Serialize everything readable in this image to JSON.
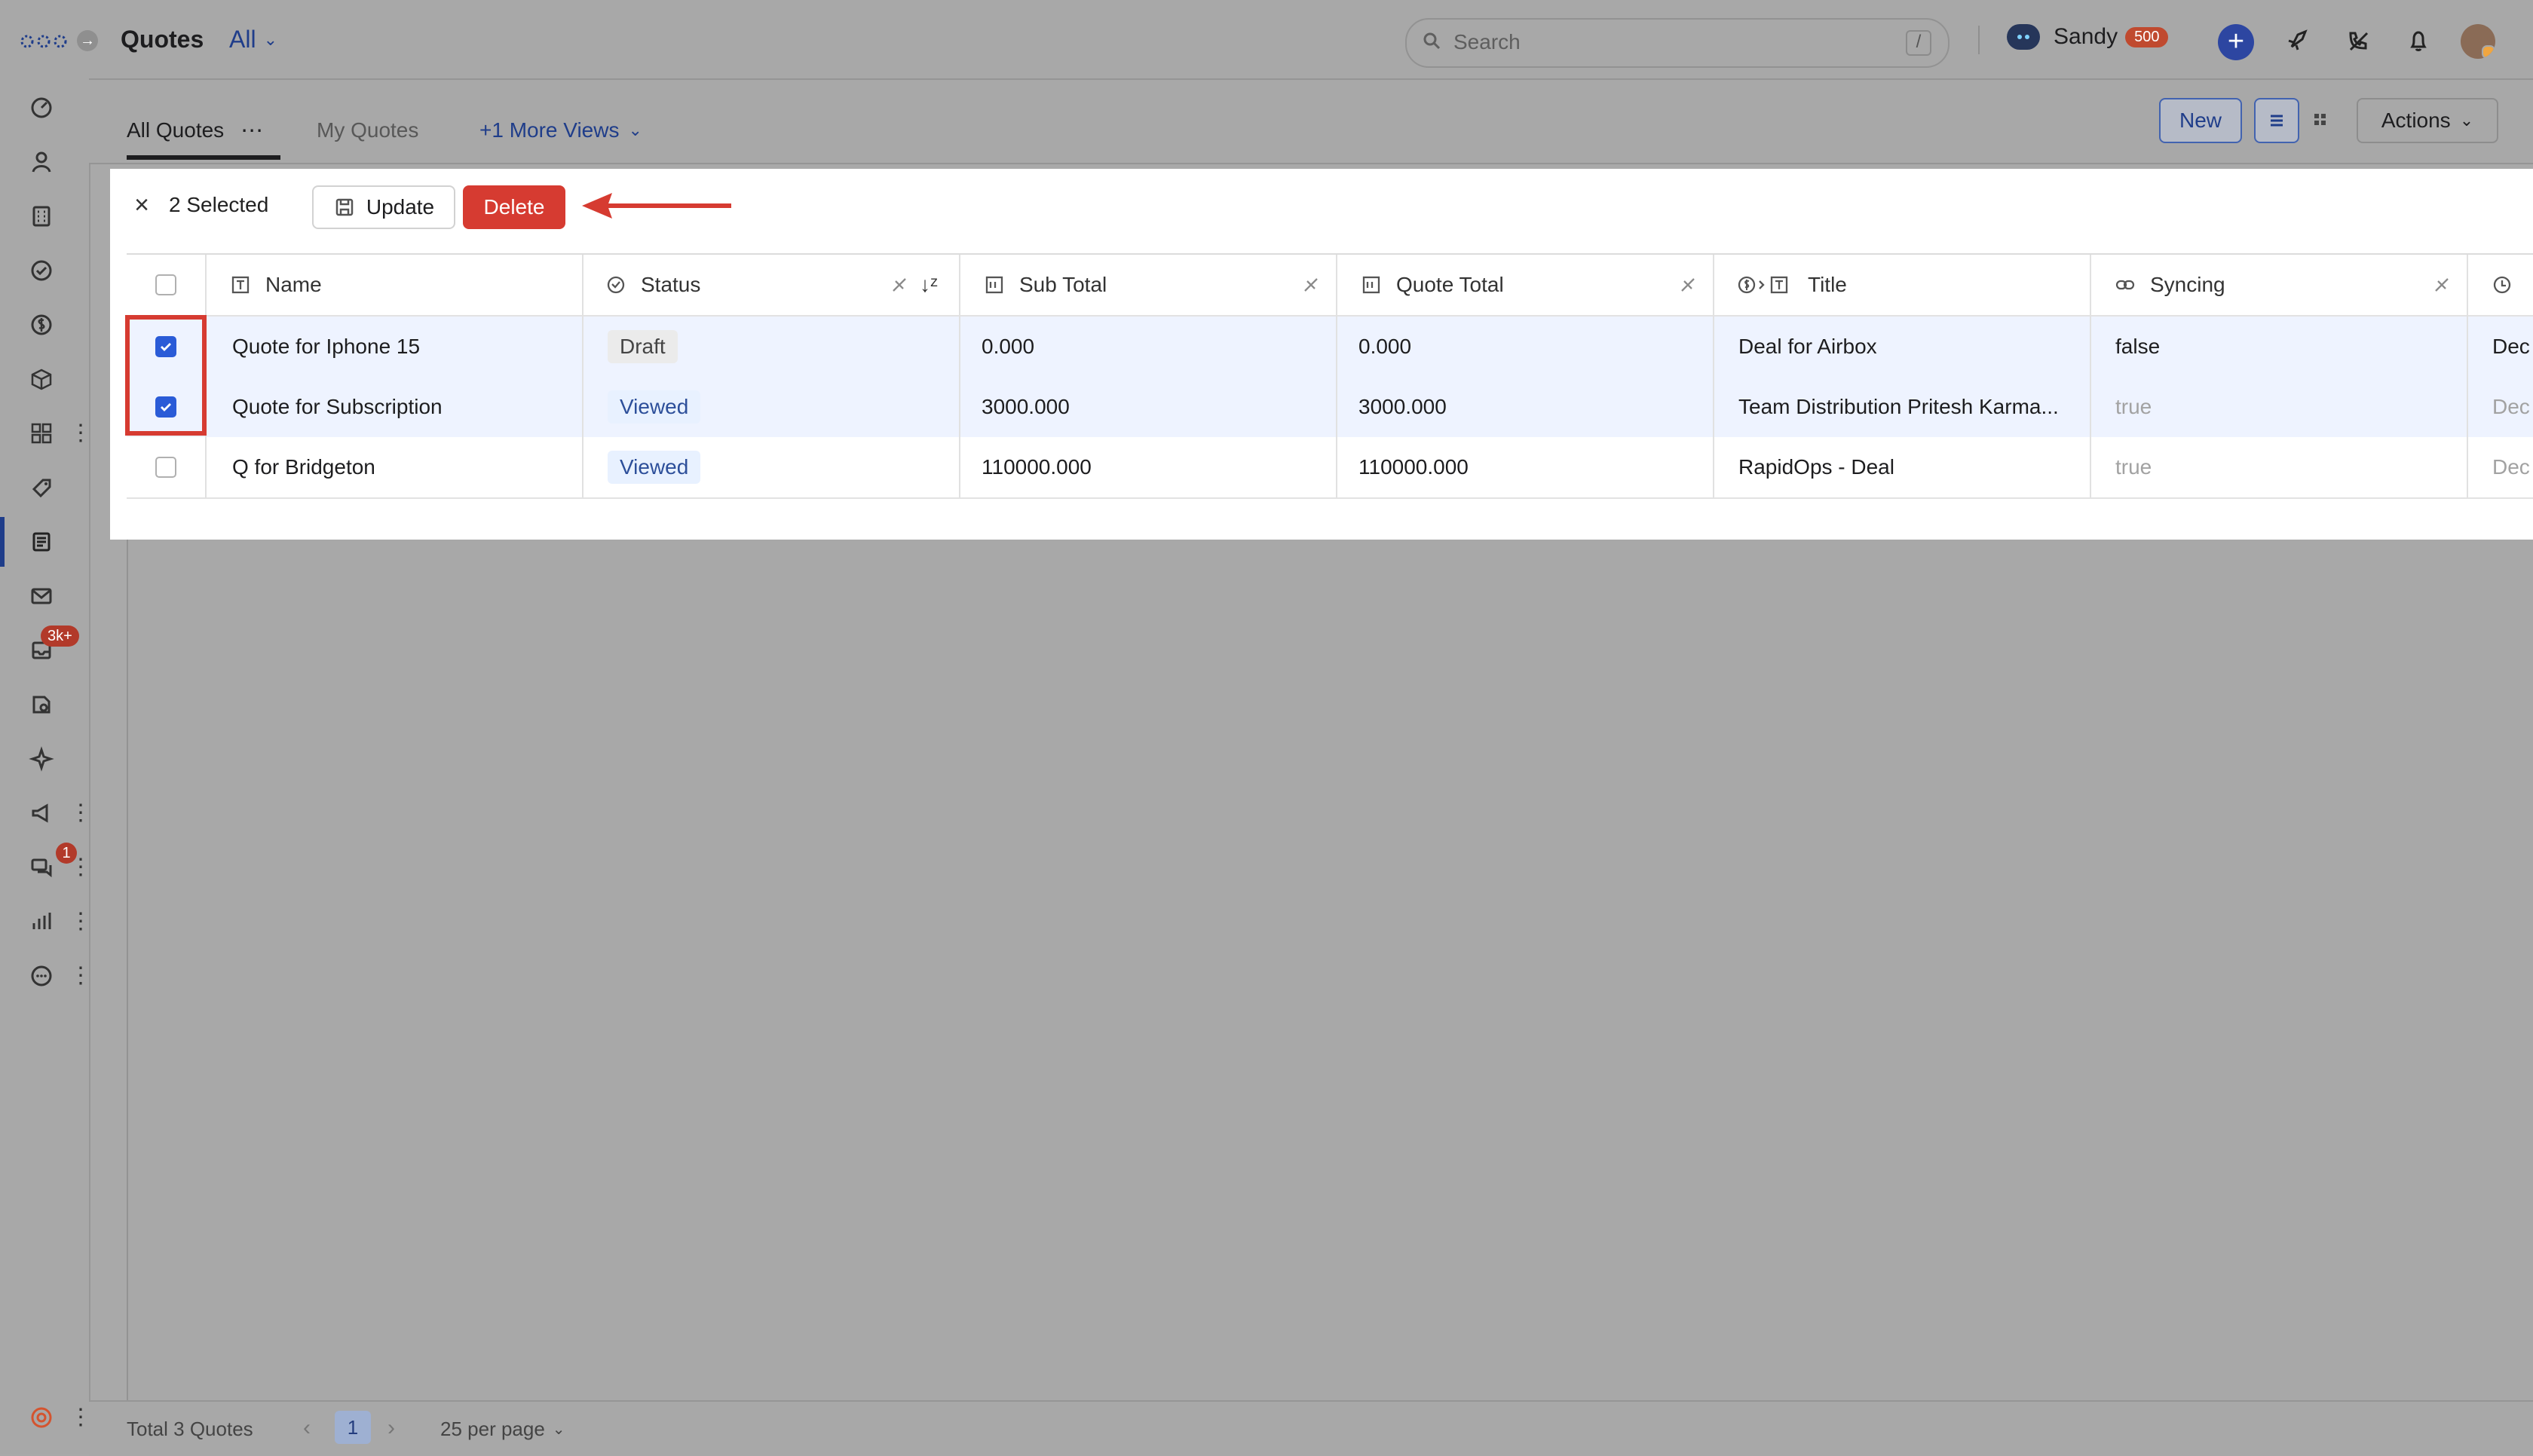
{
  "app": {
    "page_title": "Quotes",
    "filter_label": "All",
    "search_placeholder": "Search",
    "search_shortcut": "/",
    "user_name": "Sandy",
    "user_credits": "500"
  },
  "sidebar": {
    "inbox_badge": "3k+",
    "chat_badge": "1"
  },
  "views": {
    "tabs": [
      {
        "label": "All Quotes"
      },
      {
        "label": "My Quotes"
      },
      {
        "label": "+1 More Views"
      }
    ],
    "new_label": "New",
    "actions_label": "Actions"
  },
  "selection": {
    "selected_text": "2 Selected",
    "update_label": "Update",
    "delete_label": "Delete"
  },
  "table": {
    "columns": [
      {
        "label": "Name"
      },
      {
        "label": "Status"
      },
      {
        "label": "Sub Total"
      },
      {
        "label": "Quote Total"
      },
      {
        "label": "Title"
      },
      {
        "label": "Syncing"
      }
    ],
    "rows": [
      {
        "checked": true,
        "name": "Quote for Iphone 15",
        "status": "Draft",
        "sub_total": "0.000",
        "quote_total": "0.000",
        "title": "Deal for Airbox",
        "syncing": "false",
        "extra": "Dec"
      },
      {
        "checked": true,
        "name": "Quote for Subscription",
        "status": "Viewed",
        "sub_total": "3000.000",
        "quote_total": "3000.000",
        "title": "Team Distribution Pritesh Karma...",
        "syncing": "true",
        "extra": "Dec"
      },
      {
        "checked": false,
        "name": "Q for Bridgeton",
        "status": "Viewed",
        "sub_total": "110000.000",
        "quote_total": "110000.000",
        "title": "RapidOps - Deal",
        "syncing": "true",
        "extra": "Dec"
      }
    ]
  },
  "footer": {
    "total_text": "Total 3 Quotes",
    "current_page": "1",
    "per_page": "25 per page"
  },
  "colors": {
    "accent": "#2a5bd7",
    "danger": "#d63b31",
    "annotation": "#d63b31"
  }
}
